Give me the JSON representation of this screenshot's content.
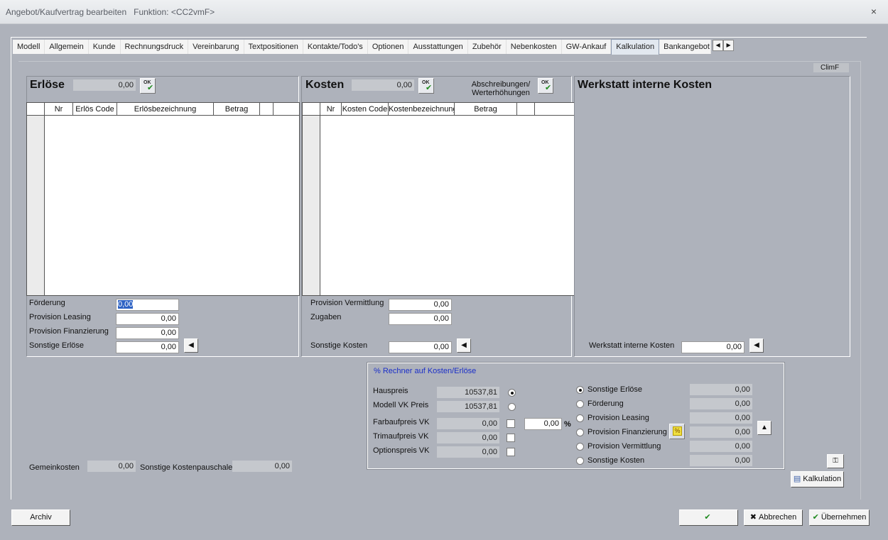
{
  "title": {
    "text": "Angebot/Kaufvertrag bearbeiten",
    "function": "Funktion: <CC2vmF>",
    "close": "×"
  },
  "tabs": [
    "Modell",
    "Allgemein",
    "Kunde",
    "Rechnungsdruck",
    "Vereinbarung",
    "Textpositionen",
    "Kontakte/Todo's",
    "Optionen",
    "Ausstattungen",
    "Zubehör",
    "Nebenkosten",
    "GW-Ankauf",
    "Kalkulation",
    "Bankangebot"
  ],
  "active_tab": "Kalkulation",
  "climf": "ClimF",
  "erloese": {
    "title": "Erlöse",
    "total": "0,00",
    "columns": [
      "Nr",
      "Erlös Code",
      "Erlösbezeichnung",
      "Betrag"
    ],
    "fields": [
      {
        "label": "Förderung",
        "value": "0,00"
      },
      {
        "label": "Provision Leasing",
        "value": "0,00"
      },
      {
        "label": "Provision Finanzierung",
        "value": "0,00"
      },
      {
        "label": "Sonstige Erlöse",
        "value": "0,00"
      }
    ]
  },
  "kosten": {
    "title": "Kosten",
    "total": "0,00",
    "abschreibungen": "Abschreibungen/ Werterhöhungen",
    "columns": [
      "Nr",
      "Kosten Code",
      "Kostenbezeichnung",
      "Betrag"
    ],
    "fields": [
      {
        "label": "Provision Vermittlung",
        "value": "0,00"
      },
      {
        "label": "Zugaben",
        "value": "0,00"
      },
      {
        "label": "Sonstige Kosten",
        "value": "0,00"
      }
    ]
  },
  "werkstatt": {
    "title": "Werkstatt interne Kosten",
    "label": "Werkstatt interne Kosten",
    "value": "0,00"
  },
  "gemein": {
    "label": "Gemeinkosten",
    "value": "0,00",
    "pauschale_label": "Sonstige Kostenpauschale",
    "pauschale_value": "0,00"
  },
  "rechner": {
    "caption": "% Rechner auf Kosten/Erlöse",
    "left": [
      {
        "label": "Hauspreis",
        "value": "10537,81"
      },
      {
        "label": "Modell VK Preis",
        "value": "10537,81"
      },
      {
        "label": "Farbaufpreis VK",
        "value": "0,00"
      },
      {
        "label": "Trimaufpreis VK",
        "value": "0,00"
      },
      {
        "label": "Optionspreis VK",
        "value": "0,00"
      }
    ],
    "percent": "0,00",
    "percent_sign": "%",
    "right": [
      {
        "label": "Sonstige Erlöse",
        "value": "0,00"
      },
      {
        "label": "Förderung",
        "value": "0,00"
      },
      {
        "label": "Provision Leasing",
        "value": "0,00"
      },
      {
        "label": "Provision Finanzierung",
        "value": "0,00"
      },
      {
        "label": "Provision Vermittlung",
        "value": "0,00"
      },
      {
        "label": "Sonstige Kosten",
        "value": "0,00"
      }
    ]
  },
  "buttons": {
    "archiv": "Archiv",
    "kalkulation": "Kalkulation",
    "abbrechen": "Abbrechen",
    "uebernehmen": "Übernehmen"
  },
  "icons": {
    "ok_text": "OK"
  }
}
